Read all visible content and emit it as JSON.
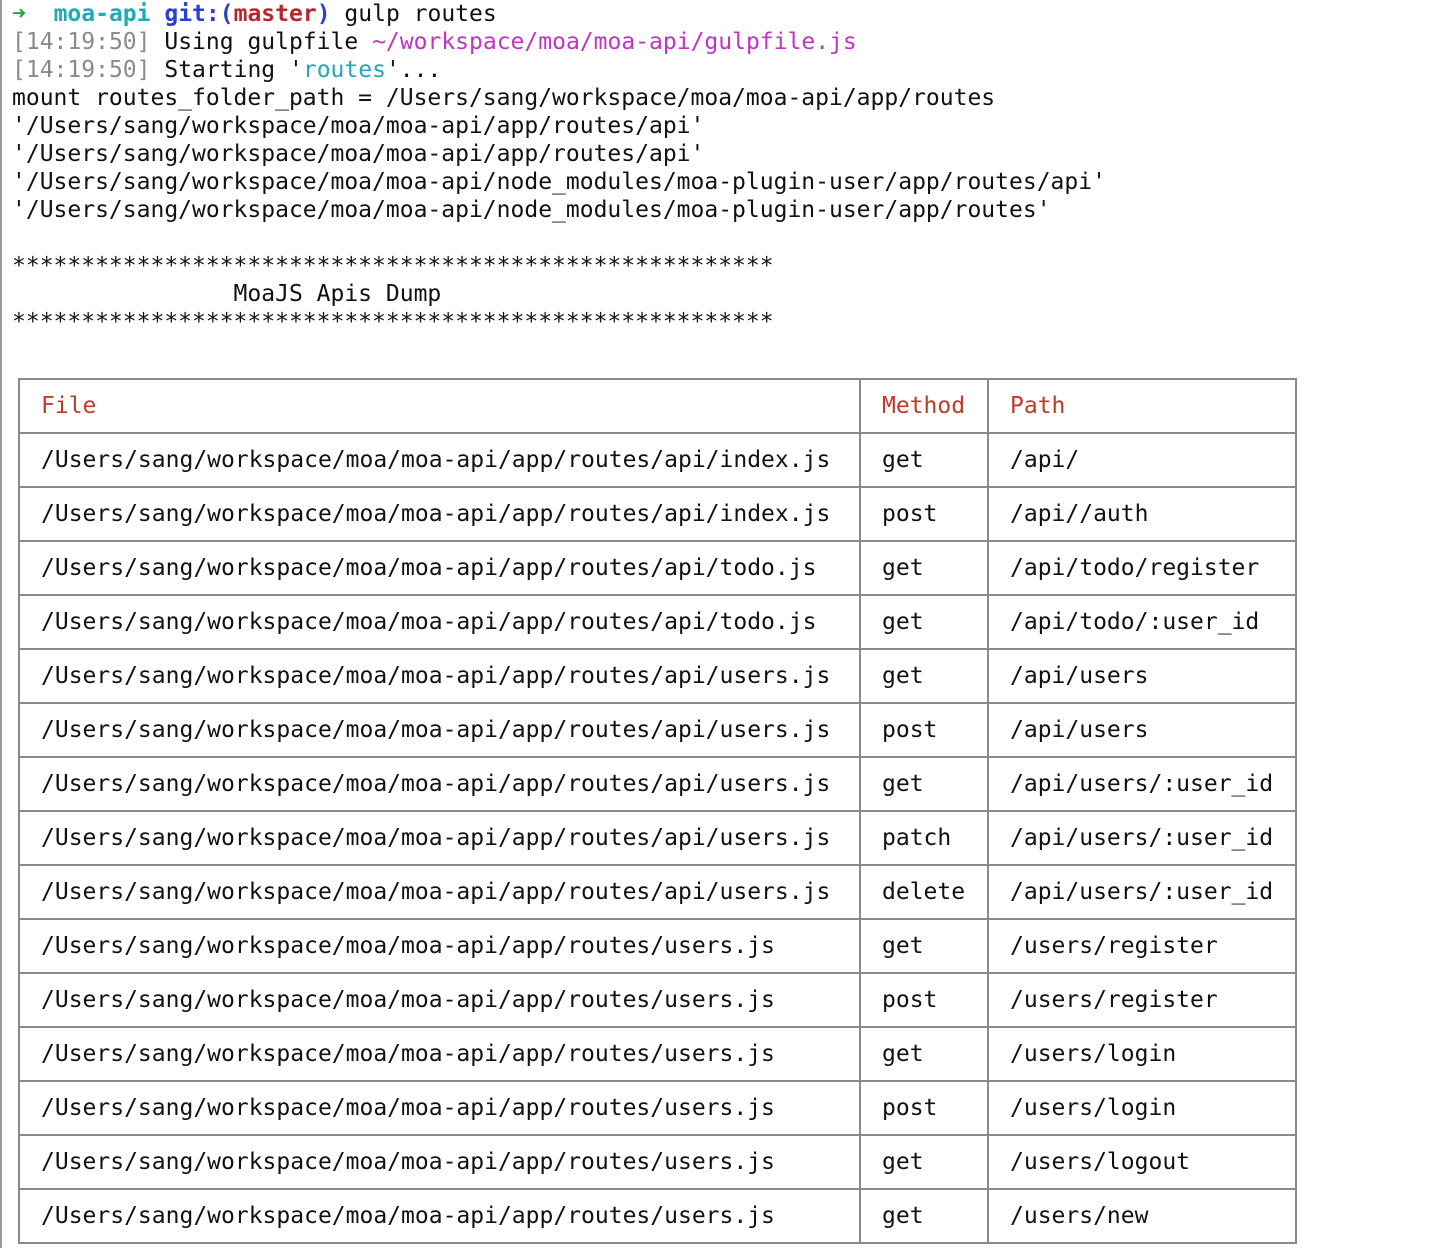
{
  "prompt": {
    "arrow": "➜",
    "dir": "moa-api",
    "git_prefix": "git:(",
    "branch": "master",
    "git_suffix": ")",
    "command": " gulp routes"
  },
  "log_lines": [
    {
      "time": "14:19:50",
      "text": "Using gulpfile ",
      "highlight": "~/workspace/moa/moa-api/gulpfile.js",
      "tail": ""
    },
    {
      "time": "14:19:50",
      "text": "Starting '",
      "highlight": "routes",
      "tail": "'..."
    }
  ],
  "output_lines": [
    "mount routes_folder_path = /Users/sang/workspace/moa/moa-api/app/routes",
    "'/Users/sang/workspace/moa/moa-api/app/routes/api'",
    "'/Users/sang/workspace/moa/moa-api/app/routes/api'",
    "'/Users/sang/workspace/moa/moa-api/node_modules/moa-plugin-user/app/routes/api'",
    "'/Users/sang/workspace/moa/moa-api/node_modules/moa-plugin-user/app/routes'"
  ],
  "banner": {
    "stars": "*******************************************************",
    "title": "                MoaJS Apis Dump"
  },
  "table": {
    "headers": [
      "File",
      "Method",
      "Path"
    ],
    "rows": [
      [
        "/Users/sang/workspace/moa/moa-api/app/routes/api/index.js",
        "get",
        "/api/"
      ],
      [
        "/Users/sang/workspace/moa/moa-api/app/routes/api/index.js",
        "post",
        "/api//auth"
      ],
      [
        "/Users/sang/workspace/moa/moa-api/app/routes/api/todo.js",
        "get",
        "/api/todo/register"
      ],
      [
        "/Users/sang/workspace/moa/moa-api/app/routes/api/todo.js",
        "get",
        "/api/todo/:user_id"
      ],
      [
        "/Users/sang/workspace/moa/moa-api/app/routes/api/users.js",
        "get",
        "/api/users"
      ],
      [
        "/Users/sang/workspace/moa/moa-api/app/routes/api/users.js",
        "post",
        "/api/users"
      ],
      [
        "/Users/sang/workspace/moa/moa-api/app/routes/api/users.js",
        "get",
        "/api/users/:user_id"
      ],
      [
        "/Users/sang/workspace/moa/moa-api/app/routes/api/users.js",
        "patch",
        "/api/users/:user_id"
      ],
      [
        "/Users/sang/workspace/moa/moa-api/app/routes/api/users.js",
        "delete",
        "/api/users/:user_id"
      ],
      [
        "/Users/sang/workspace/moa/moa-api/app/routes/users.js",
        "get",
        "/users/register"
      ],
      [
        "/Users/sang/workspace/moa/moa-api/app/routes/users.js",
        "post",
        "/users/register"
      ],
      [
        "/Users/sang/workspace/moa/moa-api/app/routes/users.js",
        "get",
        "/users/login"
      ],
      [
        "/Users/sang/workspace/moa/moa-api/app/routes/users.js",
        "post",
        "/users/login"
      ],
      [
        "/Users/sang/workspace/moa/moa-api/app/routes/users.js",
        "get",
        "/users/logout"
      ],
      [
        "/Users/sang/workspace/moa/moa-api/app/routes/users.js",
        "get",
        "/users/new"
      ]
    ]
  },
  "colors": {
    "arrow": "#23a83c",
    "dir": "#22a8b8",
    "git": "#2b3ed6",
    "branch": "#b8272d",
    "gulpfile_path": "#c233c4",
    "task_name": "#22a8b8",
    "table_header": "#c0392b",
    "table_border": "#8a8a8a"
  }
}
